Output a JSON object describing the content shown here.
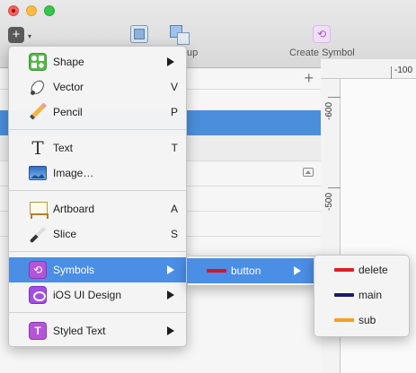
{
  "toolbar": {
    "insert_plus": "+",
    "insert_caret": "▾",
    "ungroup_label": "up",
    "create_symbol_label": "Create Symbol",
    "symbol_glyph": "⟲"
  },
  "layers": {
    "add_glyph": "+"
  },
  "rulers": {
    "horizontal_label": "-100",
    "vertical_labels": [
      "-600",
      "-500"
    ]
  },
  "insert_menu": {
    "items": [
      {
        "label": "Shape",
        "shortcut": "",
        "submenu": true,
        "icon": "shape-icon"
      },
      {
        "label": "Vector",
        "shortcut": "V",
        "submenu": false,
        "icon": "vector-pen-icon"
      },
      {
        "label": "Pencil",
        "shortcut": "P",
        "submenu": false,
        "icon": "pencil-icon"
      },
      {
        "label": "Text",
        "shortcut": "T",
        "submenu": false,
        "icon": "text-icon",
        "glyph": "T"
      },
      {
        "label": "Image…",
        "shortcut": "",
        "submenu": false,
        "icon": "image-icon"
      },
      {
        "label": "Artboard",
        "shortcut": "A",
        "submenu": false,
        "icon": "artboard-icon"
      },
      {
        "label": "Slice",
        "shortcut": "S",
        "submenu": false,
        "icon": "slice-icon"
      },
      {
        "label": "Symbols",
        "shortcut": "",
        "submenu": true,
        "icon": "symbols-icon",
        "active": true
      },
      {
        "label": "iOS UI Design",
        "shortcut": "",
        "submenu": true,
        "icon": "ios-ui-design-icon"
      },
      {
        "label": "Styled Text",
        "shortcut": "",
        "submenu": true,
        "icon": "styled-text-icon",
        "glyph": "T"
      }
    ]
  },
  "symbols_menu": {
    "items": [
      {
        "label": "button",
        "color": "#d0182a",
        "submenu": true,
        "active": true
      }
    ]
  },
  "button_menu": {
    "items": [
      {
        "label": "delete",
        "color": "#e21b2b"
      },
      {
        "label": "main",
        "color": "#1b1a6a"
      },
      {
        "label": "sub",
        "color": "#f5a01d"
      }
    ]
  },
  "colors": {
    "selection": "#4a8ee6",
    "layer_selection": "#4b8edb"
  }
}
